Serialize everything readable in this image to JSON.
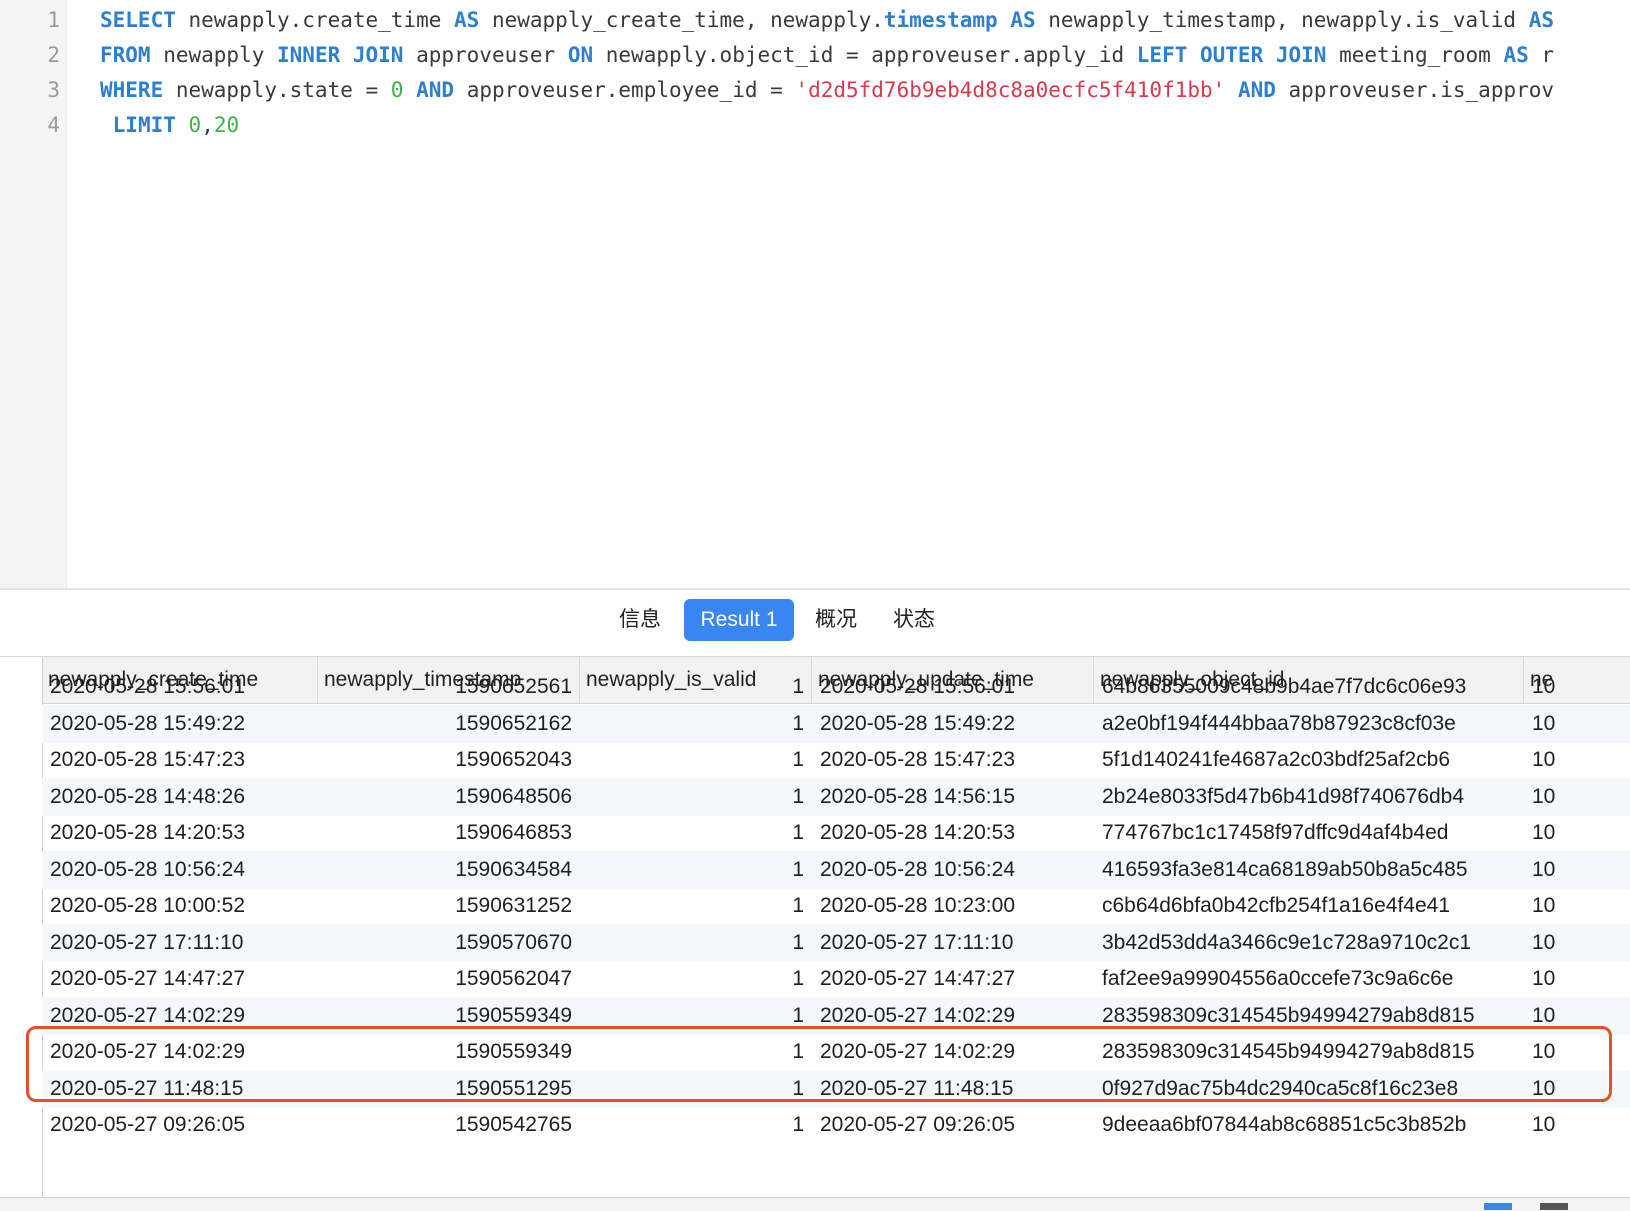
{
  "editor": {
    "line_numbers": [
      "1",
      "2",
      "3",
      "4"
    ],
    "lines": [
      [
        {
          "t": "kw",
          "v": "SELECT"
        },
        {
          "t": "p",
          "v": " newapply.create_time "
        },
        {
          "t": "kw",
          "v": "AS"
        },
        {
          "t": "p",
          "v": " newapply_create_time, newapply."
        },
        {
          "t": "kw",
          "v": "timestamp"
        },
        {
          "t": "p",
          "v": " "
        },
        {
          "t": "kw",
          "v": "AS"
        },
        {
          "t": "p",
          "v": " newapply_timestamp, newapply.is_valid "
        },
        {
          "t": "kw",
          "v": "AS"
        }
      ],
      [
        {
          "t": "kw",
          "v": "FROM"
        },
        {
          "t": "p",
          "v": " newapply "
        },
        {
          "t": "kw",
          "v": "INNER JOIN"
        },
        {
          "t": "p",
          "v": " approveuser "
        },
        {
          "t": "kw",
          "v": "ON"
        },
        {
          "t": "p",
          "v": " newapply.object_id = approveuser.apply_id "
        },
        {
          "t": "kw",
          "v": "LEFT OUTER JOIN"
        },
        {
          "t": "p",
          "v": " meeting_room "
        },
        {
          "t": "kw",
          "v": "AS"
        },
        {
          "t": "p",
          "v": " r"
        }
      ],
      [
        {
          "t": "kw",
          "v": "WHERE"
        },
        {
          "t": "p",
          "v": " newapply.state = "
        },
        {
          "t": "num",
          "v": "0"
        },
        {
          "t": "p",
          "v": " "
        },
        {
          "t": "kw",
          "v": "AND"
        },
        {
          "t": "p",
          "v": " approveuser.employee_id = "
        },
        {
          "t": "str",
          "v": "'d2d5fd76b9eb4d8c8a0ecfc5f410f1bb'"
        },
        {
          "t": "p",
          "v": " "
        },
        {
          "t": "kw",
          "v": "AND"
        },
        {
          "t": "p",
          "v": " approveuser.is_approv"
        }
      ],
      [
        {
          "t": "p",
          "v": " "
        },
        {
          "t": "kw",
          "v": "LIMIT"
        },
        {
          "t": "p",
          "v": " "
        },
        {
          "t": "num",
          "v": "0"
        },
        {
          "t": "p",
          "v": ","
        },
        {
          "t": "num",
          "v": "20"
        }
      ]
    ]
  },
  "tabs": [
    {
      "label": "信息",
      "active": false
    },
    {
      "label": "Result 1",
      "active": true
    },
    {
      "label": "概况",
      "active": false
    },
    {
      "label": "状态",
      "active": false
    }
  ],
  "grid": {
    "columns": [
      "newapply_create_time",
      "newapply_timestamp",
      "newapply_is_valid",
      "newapply_update_time",
      "newapply_object_id",
      "ne"
    ],
    "rows": [
      [
        "2020-05-28 15:56:01",
        "1590652561",
        "1",
        "2020-05-28 15:56:01",
        "64b86355009c48b9b4ae7f7dc6c06e93",
        "10"
      ],
      [
        "2020-05-28 15:49:22",
        "1590652162",
        "1",
        "2020-05-28 15:49:22",
        "a2e0bf194f444bbaa78b87923c8cf03e",
        "10"
      ],
      [
        "2020-05-28 15:47:23",
        "1590652043",
        "1",
        "2020-05-28 15:47:23",
        "5f1d140241fe4687a2c03bdf25af2cb6",
        "10"
      ],
      [
        "2020-05-28 14:48:26",
        "1590648506",
        "1",
        "2020-05-28 14:56:15",
        "2b24e8033f5d47b6b41d98f740676db4",
        "10"
      ],
      [
        "2020-05-28 14:20:53",
        "1590646853",
        "1",
        "2020-05-28 14:20:53",
        "774767bc1c17458f97dffc9d4af4b4ed",
        "10"
      ],
      [
        "2020-05-28 10:56:24",
        "1590634584",
        "1",
        "2020-05-28 10:56:24",
        "416593fa3e814ca68189ab50b8a5c485",
        "10"
      ],
      [
        "2020-05-28 10:00:52",
        "1590631252",
        "1",
        "2020-05-28 10:23:00",
        "c6b64d6bfa0b42cfb254f1a16e4f4e41",
        "10"
      ],
      [
        "2020-05-27 17:11:10",
        "1590570670",
        "1",
        "2020-05-27 17:11:10",
        "3b42d53dd4a3466c9e1c728a9710c2c1",
        "10"
      ],
      [
        "2020-05-27 14:47:27",
        "1590562047",
        "1",
        "2020-05-27 14:47:27",
        "faf2ee9a99904556a0ccefe73c9a6c6e",
        "10"
      ],
      [
        "2020-05-27 14:02:29",
        "1590559349",
        "1",
        "2020-05-27 14:02:29",
        "283598309c314545b94994279ab8d815",
        "10"
      ],
      [
        "2020-05-27 14:02:29",
        "1590559349",
        "1",
        "2020-05-27 14:02:29",
        "283598309c314545b94994279ab8d815",
        "10"
      ],
      [
        "2020-05-27 11:48:15",
        "1590551295",
        "1",
        "2020-05-27 11:48:15",
        "0f927d9ac75b4dc2940ca5c8f16c23e8",
        "10"
      ],
      [
        "2020-05-27 09:26:05",
        "1590542765",
        "1",
        "2020-05-27 09:26:05",
        "9deeaa6bf07844ab8c68851c5c3b852b",
        "10"
      ]
    ],
    "highlight_color": "#e4502a",
    "alt_row_color": "#f4f7fc"
  },
  "colors": {
    "keyword": "#2f7fd1",
    "number": "#3cb34a",
    "string": "#d93a4b",
    "active_tab": "#3a86f0"
  }
}
